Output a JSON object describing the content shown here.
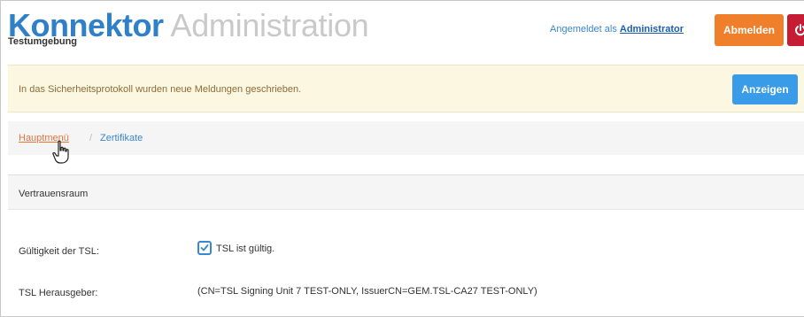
{
  "header": {
    "brand_main": "Konnektor",
    "brand_sub": "Administration",
    "environment": "Testumgebung",
    "login_prefix": "Angemeldet als",
    "login_user": "Administrator",
    "logout_label": "Abmelden",
    "power_icon": "power-icon"
  },
  "alert": {
    "message": "In das Sicherheitsprotokoll wurden neue Meldungen geschrieben.",
    "button_label": "Anzeigen"
  },
  "breadcrumb": {
    "home": "Hauptmenü",
    "separator": "/",
    "current": "Zertifikate"
  },
  "panel": {
    "title": "Vertrauensraum",
    "fields": [
      {
        "label": "Gültigkeit der TSL:",
        "checkbox_label": "TSL ist gültig.",
        "checked": true
      },
      {
        "label": "TSL Herausgeber:",
        "value": "(CN=TSL Signing Unit 7 TEST-ONLY, IssuerCN=GEM.TSL-CA27 TEST-ONLY)"
      }
    ]
  },
  "colors": {
    "brand": "#2f7fc9",
    "logout": "#f07f2c",
    "power": "#c61d35",
    "alert_bg": "#fcf7e1",
    "primary_button": "#3a9be8",
    "link_home": "#e3743a"
  }
}
